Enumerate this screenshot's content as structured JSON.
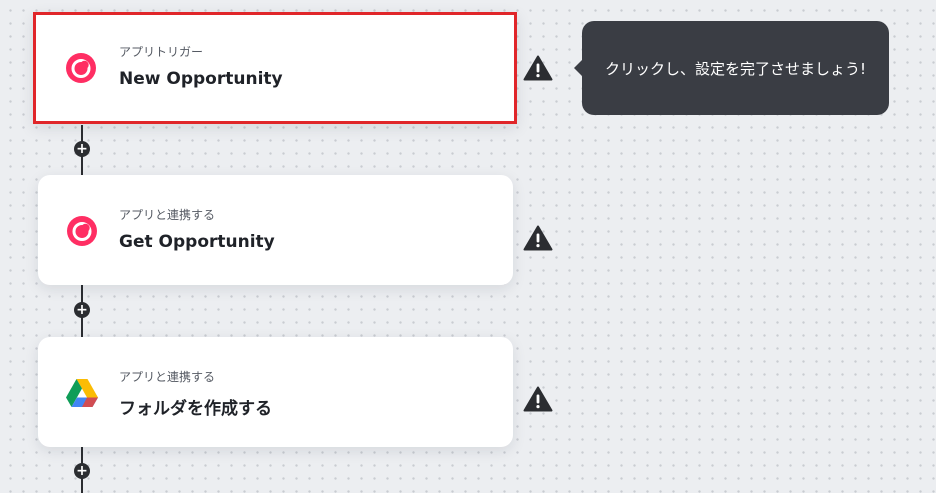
{
  "flow": {
    "steps": [
      {
        "sublabel": "アプリトリガー",
        "title": "New Opportunity",
        "app_icon": "crm-logo-icon",
        "selected": true
      },
      {
        "sublabel": "アプリと連携する",
        "title": "Get Opportunity",
        "app_icon": "crm-logo-icon",
        "selected": false
      },
      {
        "sublabel": "アプリと連携する",
        "title": "フォルダを作成する",
        "app_icon": "google-drive-icon",
        "selected": false
      }
    ],
    "add_step_symbol": "+"
  },
  "tooltip": {
    "text": "クリックし、設定を完了させましょう!"
  },
  "colors": {
    "selected_border": "#e0262a",
    "crm_brand": "#ff2e63",
    "warning": "#2b2d31",
    "tooltip_bg": "#3a3d44"
  }
}
